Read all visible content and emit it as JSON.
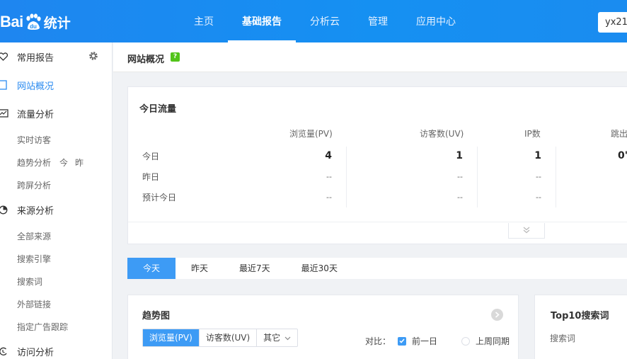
{
  "brand": {
    "logo_bai": "Bai",
    "logo_tongji": "统计"
  },
  "nav": {
    "items": [
      {
        "label": "主页"
      },
      {
        "label": "基础报告"
      },
      {
        "label": "分析云"
      },
      {
        "label": "管理"
      },
      {
        "label": "应用中心"
      }
    ],
    "active_index": 1,
    "site_selector": "yx21."
  },
  "sidebar": {
    "common_reports": "常用报告",
    "site_overview": "网站概况",
    "traffic_analysis": "流量分析",
    "realtime_visitors": "实时访客",
    "trend_analysis": "趋势分析",
    "trend_today": "今",
    "trend_yesterday": "昨",
    "cross_screen": "跨屏分析",
    "source_analysis": "来源分析",
    "all_sources": "全部来源",
    "search_engine": "搜索引擎",
    "search_words": "搜索词",
    "external_links": "外部链接",
    "ad_tracking": "指定广告跟踪",
    "visit_analysis": "访问分析"
  },
  "header": {
    "title": "网站概况",
    "help": "?"
  },
  "today_traffic": {
    "title": "今日流量",
    "columns": [
      "浏览量(PV)",
      "访客数(UV)",
      "IP数",
      "跳出"
    ],
    "rows": [
      {
        "label": "今日",
        "pv": "4",
        "uv": "1",
        "ip": "1",
        "bounce": "0'"
      },
      {
        "label": "昨日",
        "pv": "--",
        "uv": "--",
        "ip": "--"
      },
      {
        "label": "预计今日",
        "pv": "--",
        "uv": "--",
        "ip": "--"
      }
    ]
  },
  "range_tabs": [
    "今天",
    "昨天",
    "最近7天",
    "最近30天"
  ],
  "trend": {
    "title": "趋势图",
    "metrics": [
      "浏览量(PV)",
      "访客数(UV)",
      "其它"
    ],
    "compare_label": "对比：",
    "prev_day": "前一日",
    "last_week": "上周同期"
  },
  "top10": {
    "title": "Top10搜索词",
    "column": "搜索词"
  },
  "colors": {
    "topbar": "#1a8cf0",
    "accent": "#3d9bf5",
    "help_badge": "#52c41a"
  }
}
